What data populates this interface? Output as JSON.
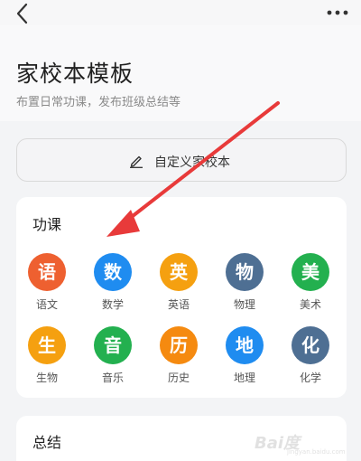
{
  "header": {
    "title": "家校本模板",
    "subtitle": "布置日常功课，发布班级总结等"
  },
  "icons": {
    "back": "chevron-left-icon",
    "more": "more-dots-icon",
    "edit": "pen-icon"
  },
  "custom_button": {
    "label": "自定义家校本"
  },
  "homework": {
    "title": "功课",
    "subjects": [
      {
        "glyph": "语",
        "label": "语文",
        "color": "#ee6030"
      },
      {
        "glyph": "数",
        "label": "数学",
        "color": "#1f8cf0"
      },
      {
        "glyph": "英",
        "label": "英语",
        "color": "#f5a010"
      },
      {
        "glyph": "物",
        "label": "物理",
        "color": "#4e6f93"
      },
      {
        "glyph": "美",
        "label": "美术",
        "color": "#23b04f"
      },
      {
        "glyph": "生",
        "label": "生物",
        "color": "#f5a010"
      },
      {
        "glyph": "音",
        "label": "音乐",
        "color": "#23b04f"
      },
      {
        "glyph": "历",
        "label": "历史",
        "color": "#f58a10"
      },
      {
        "glyph": "地",
        "label": "地理",
        "color": "#1f8cf0"
      },
      {
        "glyph": "化",
        "label": "化学",
        "color": "#4e6f93"
      }
    ]
  },
  "summary": {
    "title": "总结"
  },
  "annotation": {
    "arrow_color": "#e83a3a"
  },
  "watermark": {
    "text": "Bai度",
    "sub": "jingyan.baidu.com"
  }
}
